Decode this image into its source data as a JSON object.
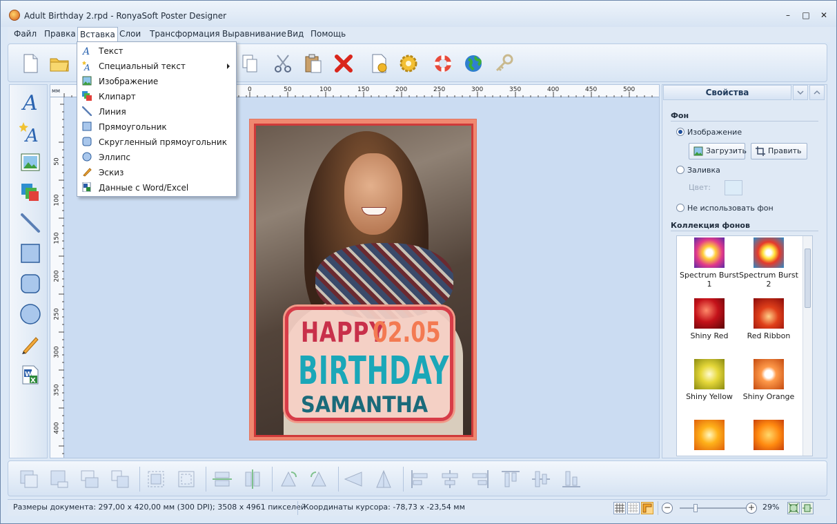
{
  "window": {
    "title": "Adult Birthday 2.rpd - RonyaSoft Poster Designer",
    "minimize": "–",
    "maximize": "□",
    "close": "✕"
  },
  "menubar": {
    "items": [
      "Файл",
      "Правка",
      "Вставка",
      "Слои",
      "Трансформация",
      "Выравнивание",
      "Вид",
      "Помощь"
    ],
    "active_index": 2
  },
  "insert_menu": {
    "items": [
      {
        "label": "Текст",
        "icon": "text-icon"
      },
      {
        "label": "Специальный текст",
        "icon": "special-text-icon",
        "submenu": true
      },
      {
        "label": "Изображение",
        "icon": "image-icon"
      },
      {
        "label": "Клипарт",
        "icon": "clipart-icon"
      },
      {
        "label": "Линия",
        "icon": "line-icon"
      },
      {
        "label": "Прямоугольник",
        "icon": "rectangle-icon"
      },
      {
        "label": "Скругленный прямоугольник",
        "icon": "rounded-rectangle-icon"
      },
      {
        "label": "Эллипс",
        "icon": "ellipse-icon"
      },
      {
        "label": "Эскиз",
        "icon": "pencil-icon"
      },
      {
        "label": "Данные с Word/Excel",
        "icon": "word-excel-icon"
      }
    ]
  },
  "ruler": {
    "unit": "мм",
    "top_ticks": [
      "0",
      "50",
      "100",
      "150",
      "200",
      "250",
      "300",
      "350",
      "400",
      "450",
      "500"
    ],
    "left_ticks": [
      "50",
      "100",
      "150",
      "200",
      "250",
      "300",
      "350",
      "400"
    ]
  },
  "poster": {
    "happy": "HAPPY",
    "date": "02.05",
    "birthday": "BIRTHDAY",
    "name": "SAMANTHA"
  },
  "properties": {
    "header": "Свойства",
    "background_section": "Фон",
    "radio_image": "Изображение",
    "load_button": "Загрузить",
    "edit_button": "Править",
    "radio_fill": "Заливка",
    "color_label": "Цвет:",
    "radio_none": "Не использовать фон",
    "collection_section": "Коллекция фонов",
    "collection": [
      {
        "label": "Spectrum Burst 1"
      },
      {
        "label": "Spectrum Burst 2"
      },
      {
        "label": "Shiny Red"
      },
      {
        "label": "Red Ribbon"
      },
      {
        "label": "Shiny Yellow"
      },
      {
        "label": "Shiny Orange"
      }
    ]
  },
  "status": {
    "doc_size": "Размеры документа: 297,00 x 420,00 мм (300 DPI); 3508 x 4961 пикселей",
    "cursor": "Координаты курсора: -78,73 x -23,54 мм",
    "zoom_minus": "−",
    "zoom_plus": "+",
    "zoom": "29%"
  }
}
